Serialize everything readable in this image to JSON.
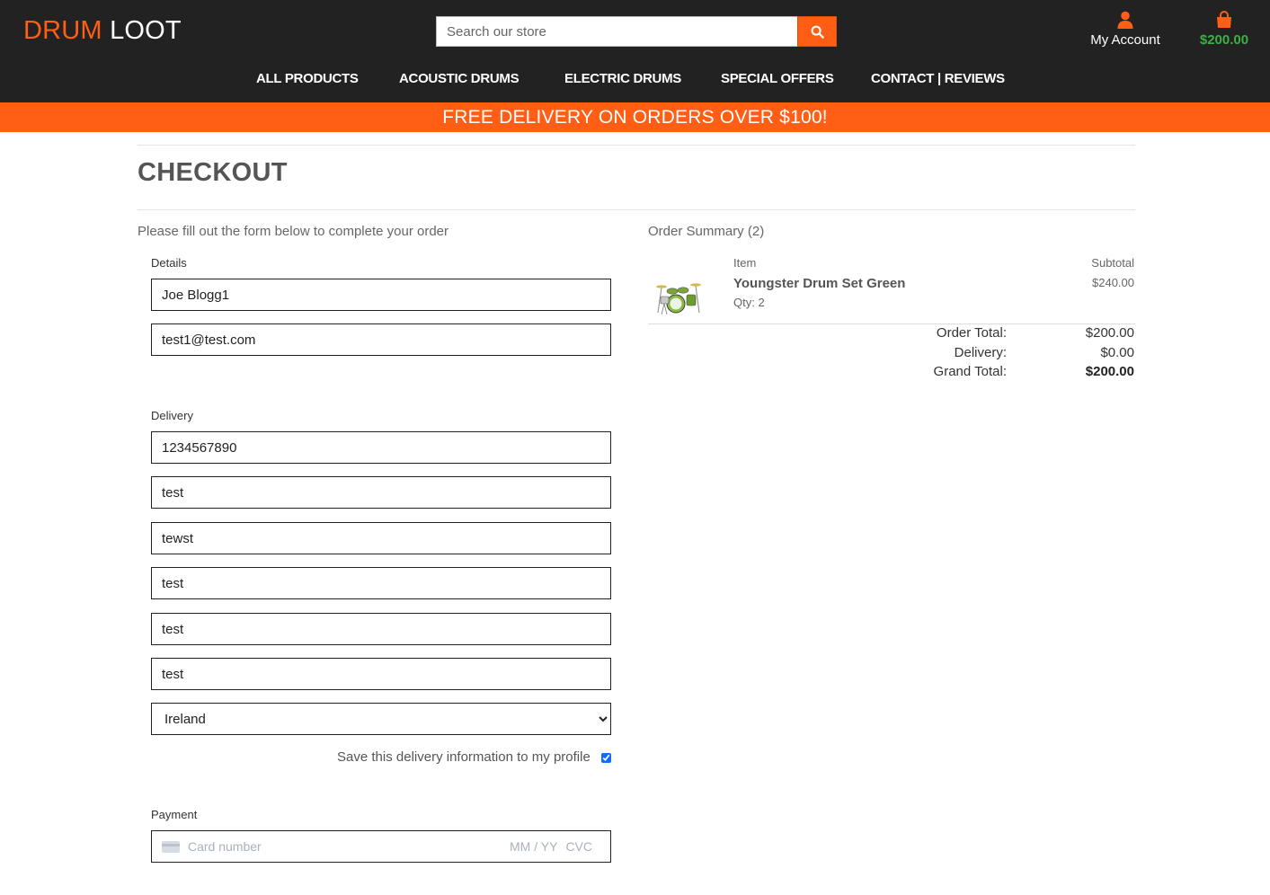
{
  "brand": {
    "part1": "DRUM",
    "part2": "LOOT"
  },
  "search": {
    "placeholder": "Search our store"
  },
  "account": {
    "label": "My Account"
  },
  "cart": {
    "total": "$200.00"
  },
  "nav": [
    {
      "label": "ALL PRODUCTS"
    },
    {
      "label": "ACOUSTIC DRUMS"
    },
    {
      "label": "ELECTRIC DRUMS"
    },
    {
      "label": "SPECIAL OFFERS"
    },
    {
      "label": "CONTACT | REVIEWS"
    }
  ],
  "banner": "FREE DELIVERY ON ORDERS OVER $100!",
  "page": {
    "title": "CHECKOUT",
    "intro": "Please fill out the form below to complete your order"
  },
  "form": {
    "details_label": "Details",
    "full_name": "Joe Blogg1",
    "email": "test1@test.com",
    "delivery_label": "Delivery",
    "phone": "1234567890",
    "address1": "test",
    "address2": "tewst",
    "town": "test",
    "county": "test",
    "postcode": "test",
    "country": "Ireland",
    "save_label": "Save this delivery information to my profile",
    "save_checked": true,
    "payment_label": "Payment",
    "card_placeholder": "Card number",
    "expiry_placeholder": "MM / YY",
    "cvc_placeholder": "CVC"
  },
  "summary": {
    "title": "Order Summary (2)",
    "col_item": "Item",
    "col_subtotal": "Subtotal",
    "items": [
      {
        "name": "Youngster Drum Set Green",
        "qty": "Qty: 2",
        "subtotal": "$240.00"
      }
    ],
    "order_total_label": "Order Total:",
    "order_total": "$200.00",
    "delivery_label": "Delivery:",
    "delivery": "$0.00",
    "grand_total_label": "Grand Total:",
    "grand_total": "$200.00"
  },
  "colors": {
    "accent": "#ff5e14",
    "header_bg": "#222222",
    "cart_green": "#3cb043"
  }
}
